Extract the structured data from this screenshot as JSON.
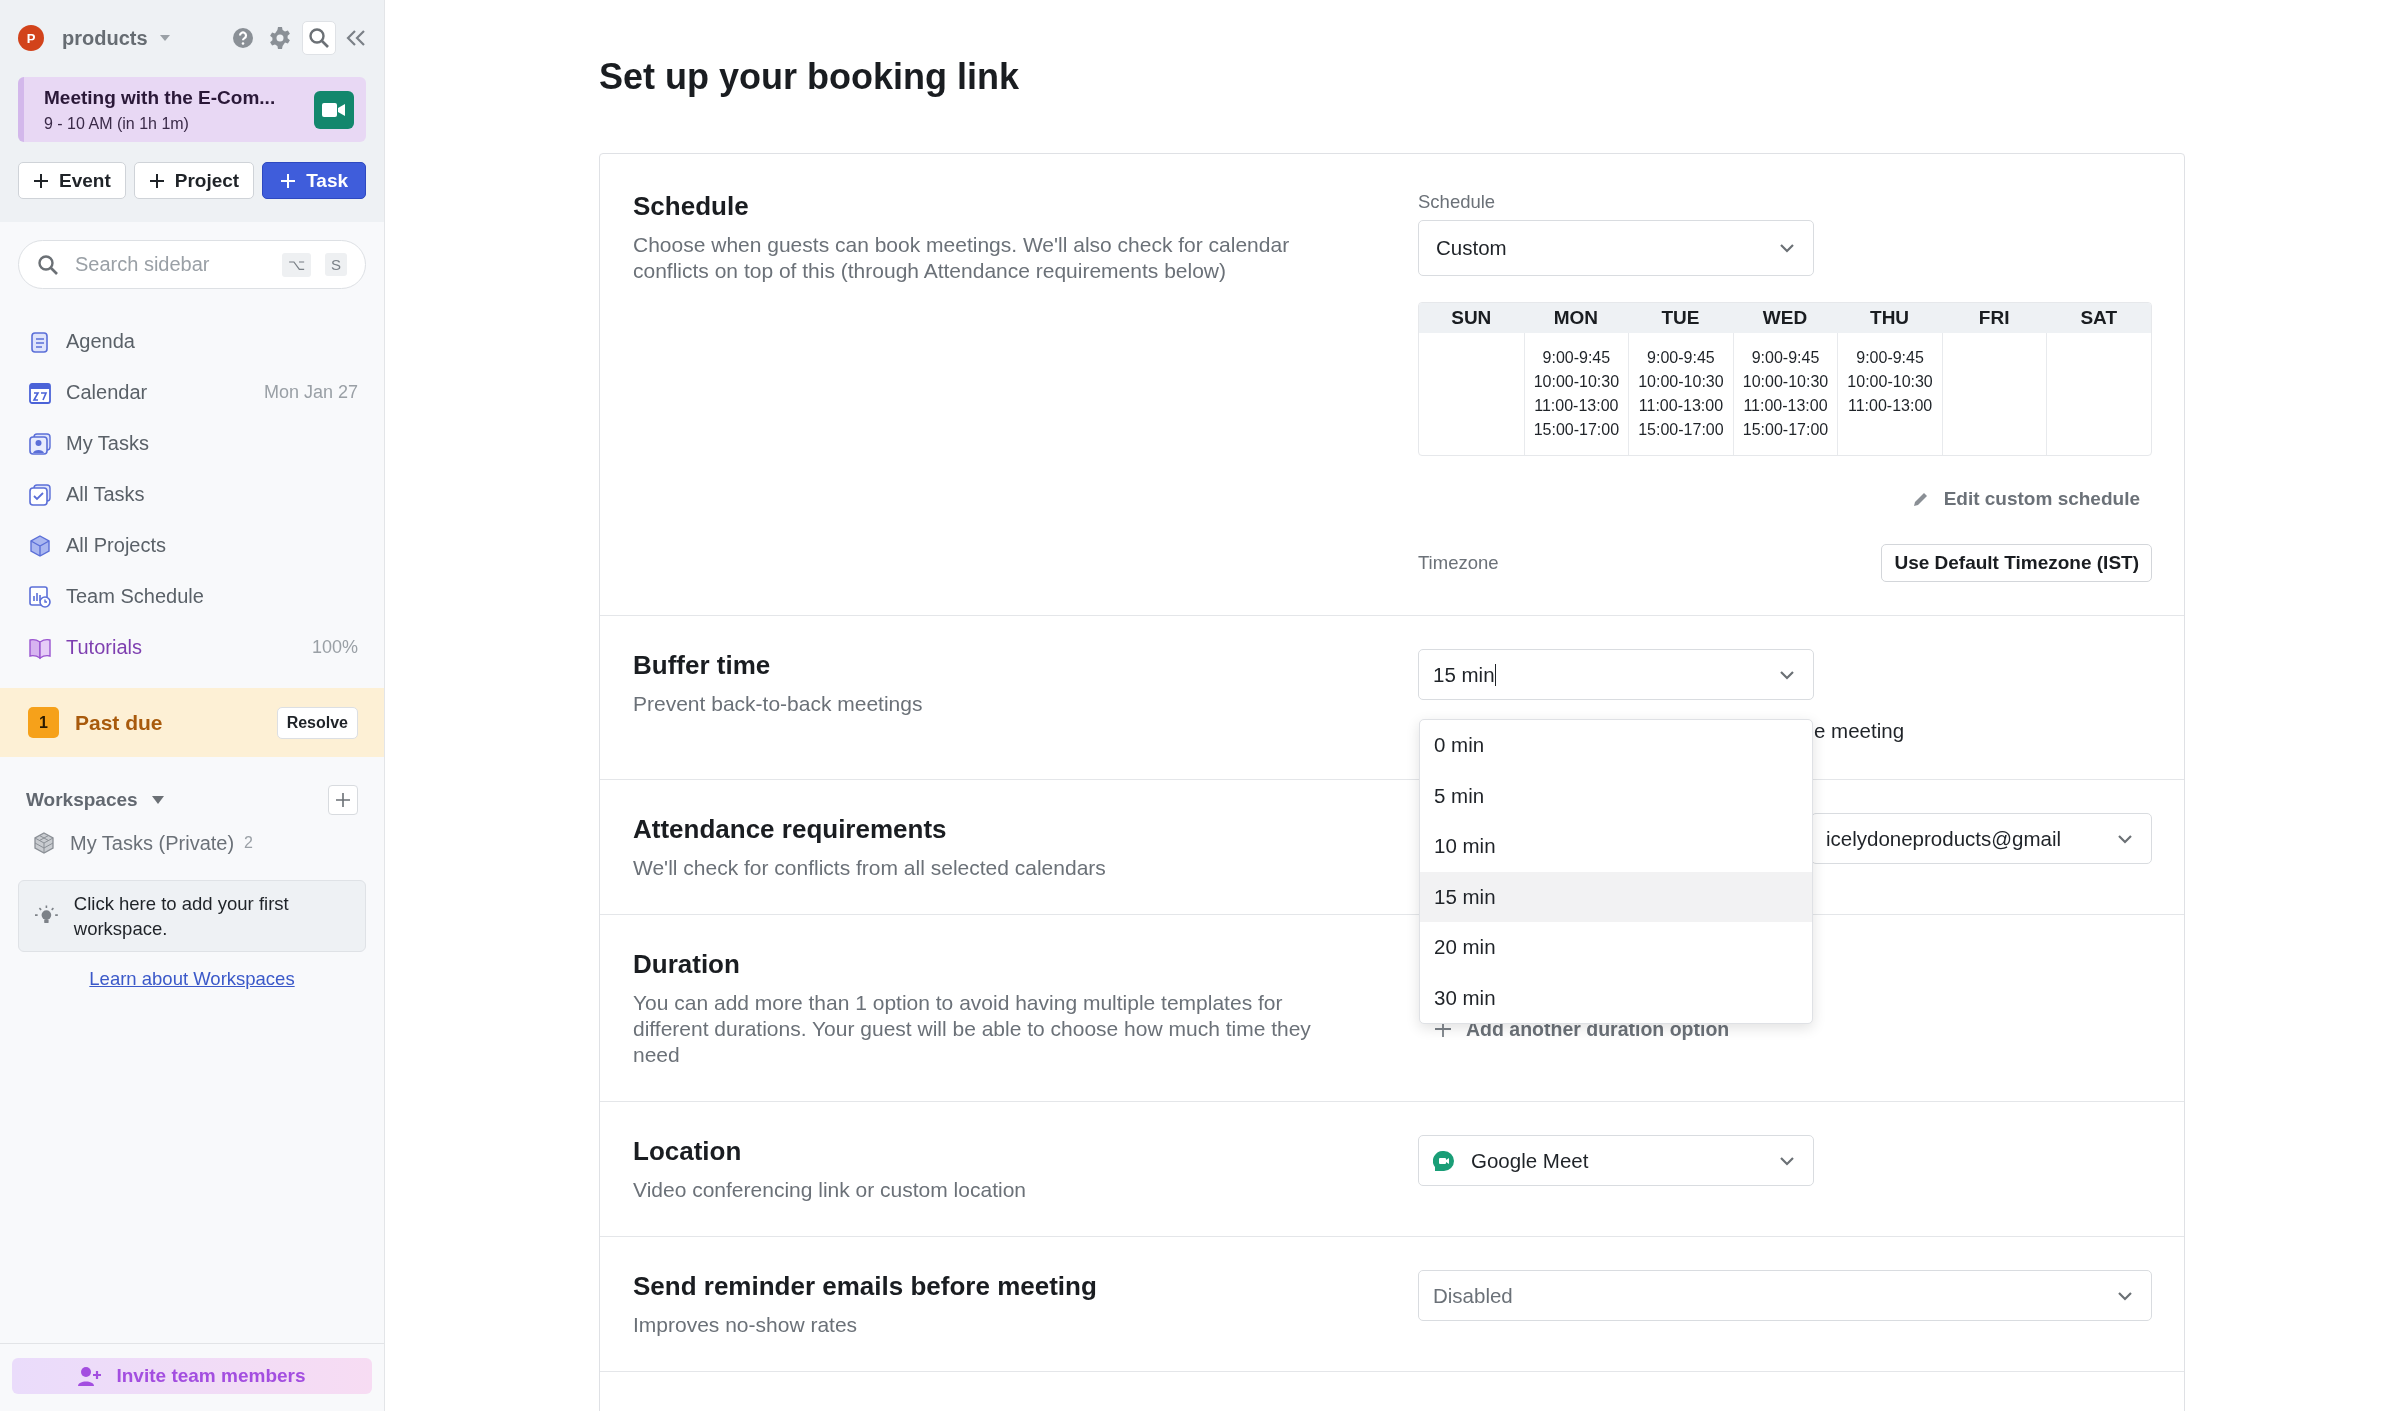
{
  "sidebar": {
    "workspace": {
      "avatar": "P",
      "name": "products"
    },
    "meeting": {
      "title": "Meeting with the E-Com...",
      "time": "9 - 10 AM (in 1h 1m)"
    },
    "buttons": [
      {
        "label": "Event",
        "primary": false
      },
      {
        "label": "Project",
        "primary": false
      },
      {
        "label": "Task",
        "primary": true
      }
    ],
    "search": {
      "placeholder": "Search sidebar",
      "keys": [
        "⌥",
        "S"
      ]
    },
    "nav": [
      {
        "label": "Agenda",
        "highlighted": false
      },
      {
        "label": "Calendar",
        "meta": "Mon Jan 27",
        "highlighted": false
      },
      {
        "label": "My Tasks",
        "highlighted": false
      },
      {
        "label": "All Tasks",
        "highlighted": false
      },
      {
        "label": "All Projects",
        "highlighted": false
      },
      {
        "label": "Team Schedule",
        "highlighted": false
      },
      {
        "label": "Tutorials",
        "meta": "100%",
        "highlighted": true
      }
    ],
    "past_due": {
      "count": "1",
      "label": "Past due",
      "action": "Resolve"
    },
    "workspaces": {
      "title": "Workspaces",
      "items": [
        {
          "label": "My Tasks (Private)",
          "count": "2"
        }
      ],
      "tip": "Click here to add your first workspace.",
      "link": "Learn about Workspaces"
    },
    "invite": "Invite team members"
  },
  "main": {
    "title": "Set up your booking link",
    "sections": [
      {
        "kind": "schedule",
        "title": "Schedule",
        "description": "Choose when guests can book meetings. We'll also check for calendar conflicts on top of this (through Attendance requirements below)",
        "field_label": "Schedule",
        "value": "Custom",
        "days": [
          {
            "name": "SUN"
          },
          {
            "name": "MON",
            "slots": [
              "9:00-9:45",
              "10:00-10:30",
              "11:00-13:00",
              "15:00-17:00"
            ]
          },
          {
            "name": "TUE",
            "slots": [
              "9:00-9:45",
              "10:00-10:30",
              "11:00-13:00",
              "15:00-17:00"
            ]
          },
          {
            "name": "WED",
            "slots": [
              "9:00-9:45",
              "10:00-10:30",
              "11:00-13:00",
              "15:00-17:00"
            ]
          },
          {
            "name": "THU",
            "slots": [
              "9:00-9:45",
              "10:00-10:30",
              "11:00-13:00"
            ]
          },
          {
            "name": "FRI"
          },
          {
            "name": "SAT"
          }
        ],
        "edit_link": "Edit custom schedule",
        "timezone_label": "Timezone",
        "timezone_button": "Use Default Timezone (IST)"
      },
      {
        "kind": "buffer",
        "title": "Buffer time",
        "description": "Prevent back-to-back meetings",
        "value": "15 min",
        "note": "e meeting",
        "options": [
          {
            "label": "0 min",
            "selected": false
          },
          {
            "label": "5 min",
            "selected": false
          },
          {
            "label": "10 min",
            "selected": false
          },
          {
            "label": "15 min",
            "selected": true
          },
          {
            "label": "20 min",
            "selected": false
          },
          {
            "label": "30 min",
            "selected": false
          }
        ]
      },
      {
        "kind": "attendance",
        "title": "Attendance requirements",
        "description": "We'll check for conflicts from all selected calendars",
        "value": "icelydoneproducts@gmail"
      },
      {
        "kind": "duration",
        "title": "Duration",
        "description": "You can add more than 1 option to avoid having multiple templates for different durations. Your guest will be able to choose how much time they need",
        "add_option": "Add another duration option"
      },
      {
        "kind": "location",
        "title": "Location",
        "description": "Video conferencing link or custom location",
        "value": "Google Meet"
      },
      {
        "kind": "reminder",
        "title": "Send reminder emails before meeting",
        "description": "Improves no-show rates",
        "value": "Disabled"
      }
    ]
  }
}
